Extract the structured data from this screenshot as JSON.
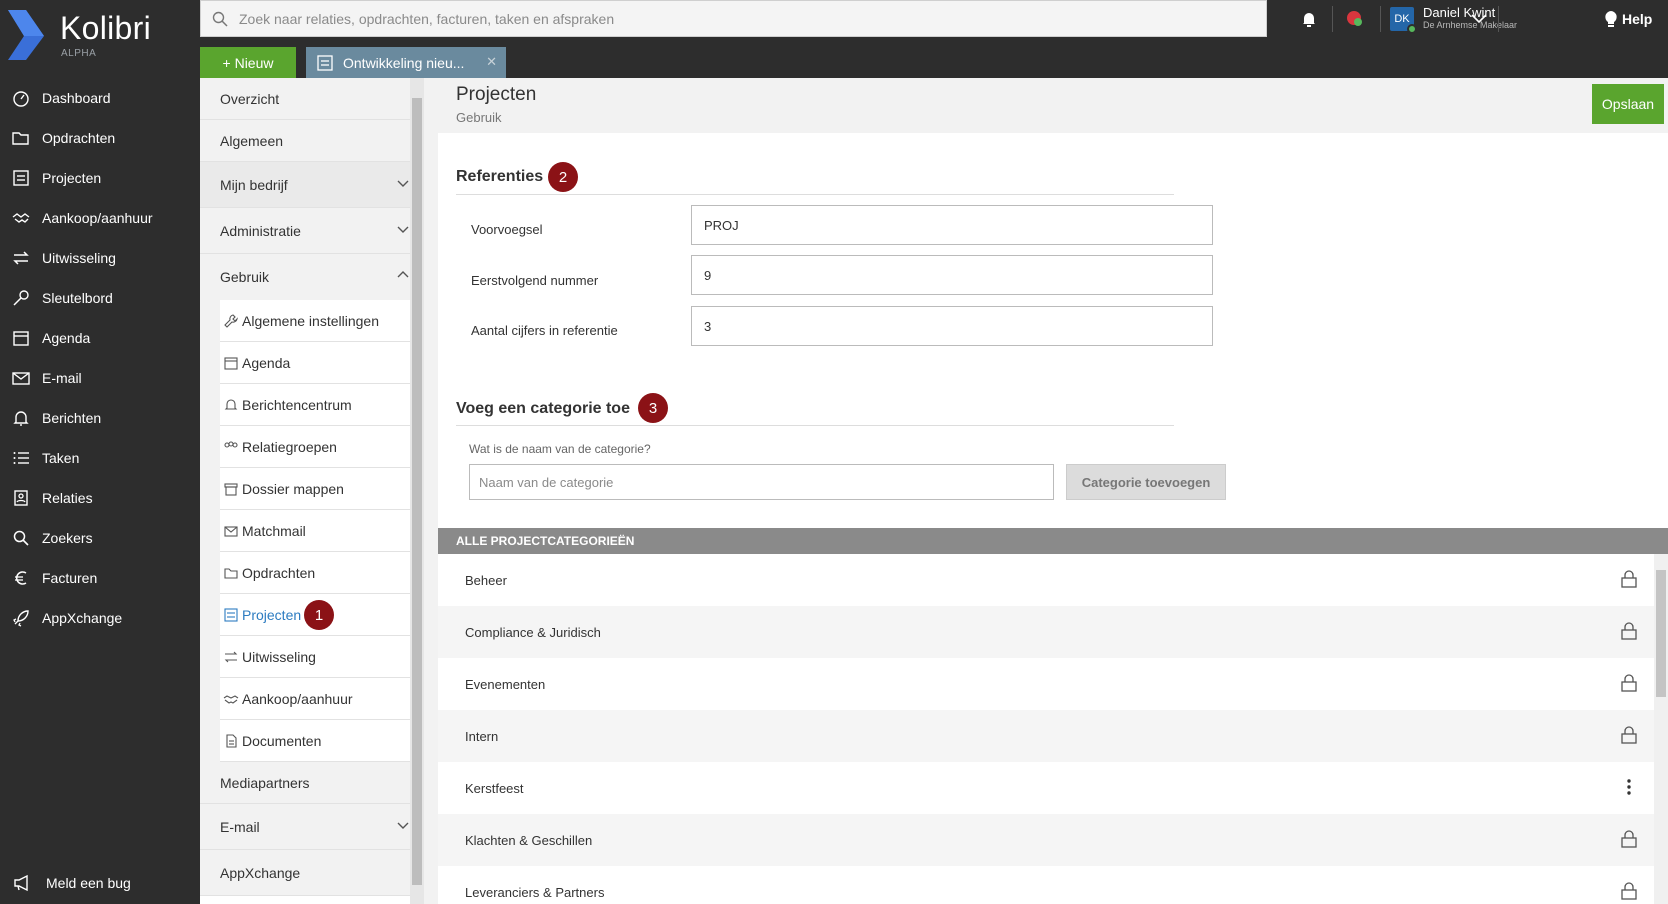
{
  "app": {
    "name": "Kolibri",
    "subtitle": "ALPHA"
  },
  "nav": [
    {
      "label": "Dashboard",
      "icon": "dashboard-icon"
    },
    {
      "label": "Opdrachten",
      "icon": "folder-open-icon"
    },
    {
      "label": "Projecten",
      "icon": "project-icon"
    },
    {
      "label": "Aankoop/aanhuur",
      "icon": "handshake-icon"
    },
    {
      "label": "Uitwisseling",
      "icon": "exchange-icon"
    },
    {
      "label": "Sleutelbord",
      "icon": "key-icon"
    },
    {
      "label": "Agenda",
      "icon": "calendar-icon"
    },
    {
      "label": "E-mail",
      "icon": "envelope-icon"
    },
    {
      "label": "Berichten",
      "icon": "bell-icon"
    },
    {
      "label": "Taken",
      "icon": "tasks-icon"
    },
    {
      "label": "Relaties",
      "icon": "contact-icon"
    },
    {
      "label": "Zoekers",
      "icon": "search-icon"
    },
    {
      "label": "Facturen",
      "icon": "euro-icon"
    },
    {
      "label": "AppXchange",
      "icon": "rocket-icon"
    }
  ],
  "bug_report": "Meld een bug",
  "search": {
    "placeholder": "Zoek naar relaties, opdrachten, facturen, taken en afspraken"
  },
  "user": {
    "initials": "DK",
    "name": "Daniel Kwint",
    "company": "De Arnhemse Makelaar"
  },
  "help": "Help",
  "tabs": {
    "new_label": "+ Nieuw",
    "open_tab": "Ontwikkeling nieu..."
  },
  "settings": {
    "overzicht": "Overzicht",
    "algemeen": "Algemeen",
    "mijn_bedrijf": "Mijn bedrijf",
    "administratie": "Administratie",
    "gebruik": "Gebruik",
    "sub_items": [
      "Algemene instellingen",
      "Agenda",
      "Berichtencentrum",
      "Relatiegroepen",
      "Dossier mappen",
      "Matchmail",
      "Opdrachten",
      "Projecten",
      "Uitwisseling",
      "Aankoop/aanhuur",
      "Documenten"
    ],
    "mediapartners": "Mediapartners",
    "email": "E-mail",
    "appxchange": "AppXchange"
  },
  "page": {
    "title": "Projecten",
    "subtitle": "Gebruik",
    "save_label": "Opslaan"
  },
  "references": {
    "title": "Referenties",
    "fields": [
      {
        "label": "Voorvoegsel",
        "value": "PROJ"
      },
      {
        "label": "Eerstvolgend nummer",
        "value": "9"
      },
      {
        "label": "Aantal cijfers in referentie",
        "value": "3"
      }
    ]
  },
  "add_category": {
    "title": "Voeg een categorie toe",
    "question": "Wat is de naam van de categorie?",
    "placeholder": "Naam van de categorie",
    "button": "Categorie toevoegen"
  },
  "categories": {
    "header": "ALLE PROJECTCATEGORIEËN",
    "items": [
      {
        "name": "Beheer",
        "action": "lock-icon"
      },
      {
        "name": "Compliance & Juridisch",
        "action": "lock-icon"
      },
      {
        "name": "Evenementen",
        "action": "lock-icon"
      },
      {
        "name": "Intern",
        "action": "lock-icon"
      },
      {
        "name": "Kerstfeest",
        "action": "more-vertical-icon"
      },
      {
        "name": "Klachten & Geschillen",
        "action": "lock-icon"
      },
      {
        "name": "Leveranciers & Partners",
        "action": "lock-icon"
      }
    ]
  },
  "badges": {
    "one": "1",
    "two": "2",
    "three": "3"
  },
  "colors": {
    "accent_green": "#5aa52e",
    "sidebar_dark": "#2d2d2d",
    "badge_red": "#8b1216",
    "link_blue": "#2d7cc1"
  }
}
